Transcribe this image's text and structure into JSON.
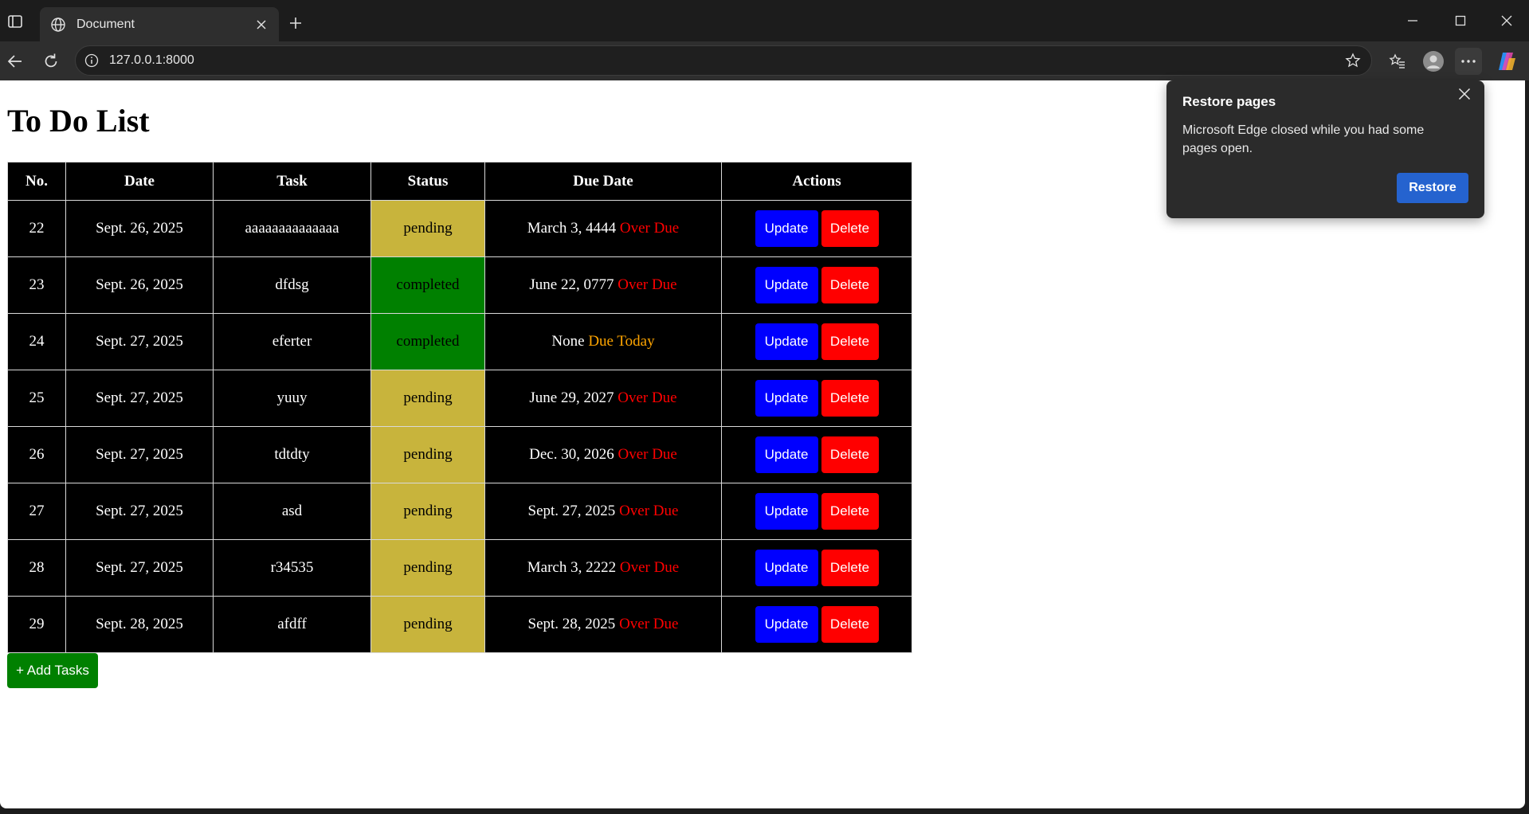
{
  "browser": {
    "tab_title": "Document",
    "url": "127.0.0.1:8000"
  },
  "page": {
    "title": "To Do List",
    "add_button": "+ Add Tasks"
  },
  "table": {
    "headers": [
      "No.",
      "Date",
      "Task",
      "Status",
      "Due Date",
      "Actions"
    ],
    "update_label": "Update",
    "delete_label": "Delete",
    "rows": [
      {
        "no": "22",
        "date": "Sept. 26, 2025",
        "task": "aaaaaaaaaaaaaa",
        "status": "pending",
        "due": "March 3, 4444",
        "flag": "Over Due"
      },
      {
        "no": "23",
        "date": "Sept. 26, 2025",
        "task": "dfdsg",
        "status": "completed",
        "due": "June 22, 0777",
        "flag": "Over Due"
      },
      {
        "no": "24",
        "date": "Sept. 27, 2025",
        "task": "eferter",
        "status": "completed",
        "due": "None",
        "flag": "Due Today"
      },
      {
        "no": "25",
        "date": "Sept. 27, 2025",
        "task": "yuuy",
        "status": "pending",
        "due": "June 29, 2027",
        "flag": "Over Due"
      },
      {
        "no": "26",
        "date": "Sept. 27, 2025",
        "task": "tdtdty",
        "status": "pending",
        "due": "Dec. 30, 2026",
        "flag": "Over Due"
      },
      {
        "no": "27",
        "date": "Sept. 27, 2025",
        "task": "asd",
        "status": "pending",
        "due": "Sept. 27, 2025",
        "flag": "Over Due"
      },
      {
        "no": "28",
        "date": "Sept. 27, 2025",
        "task": "r34535",
        "status": "pending",
        "due": "March 3, 2222",
        "flag": "Over Due"
      },
      {
        "no": "29",
        "date": "Sept. 28, 2025",
        "task": "afdff",
        "status": "pending",
        "due": "Sept. 28, 2025",
        "flag": "Over Due"
      }
    ]
  },
  "popup": {
    "title": "Restore pages",
    "body": "Microsoft Edge closed while you had some pages open.",
    "button": "Restore"
  },
  "colors": {
    "pending": "#c8b43c",
    "completed": "#008000",
    "update": "#0000ff",
    "delete": "#ff0000",
    "overdue": "#ff0000",
    "due_today": "#ffa500"
  }
}
